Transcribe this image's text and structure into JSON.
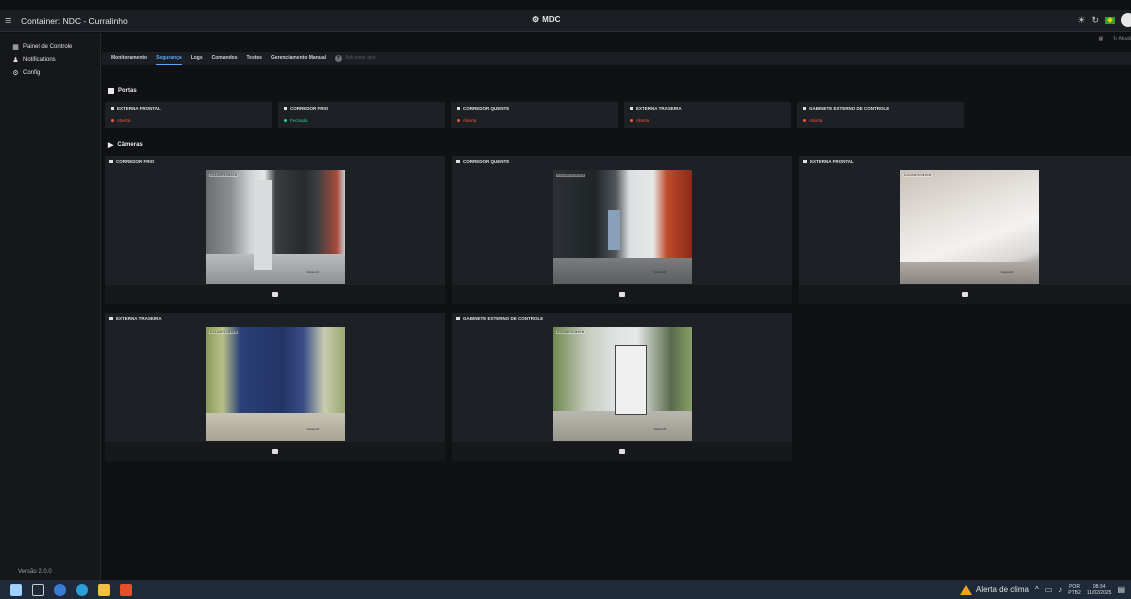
{
  "topbar": {
    "menu_icon": "menu-icon",
    "title": "Container: NDC - Curralinho",
    "center_icon": "gear-icon",
    "center_label": "MDC",
    "right_icons": [
      "sun-icon",
      "refresh-icon",
      "flag-icon",
      "avatar-icon"
    ]
  },
  "sidebar": {
    "items": [
      {
        "label": "Painel de Controle",
        "icon": "dashboard-icon"
      },
      {
        "label": "Notifications",
        "icon": "bell-icon"
      },
      {
        "label": "Config",
        "icon": "gear-icon"
      }
    ],
    "version": "Versão 2.0.0"
  },
  "toolbar_right": {
    "grid_icon": "grid-icon",
    "refresh_label": "Atuali"
  },
  "tabs": {
    "items": [
      "Monitoramento",
      "Segurança",
      "Logs",
      "Comandos",
      "Testes",
      "Gerenciamento Manual"
    ],
    "active": "Segurança",
    "add_label": "Adicionar aba"
  },
  "portas": {
    "title": "Portas",
    "doors": [
      {
        "name": "EXTERNA FRONTAL",
        "status": "Aberta",
        "color": "#f05a3a"
      },
      {
        "name": "CORREDOR FRIO",
        "status": "Fechada",
        "color": "#2ecc8a"
      },
      {
        "name": "CORREDOR QUENTE",
        "status": "Aberta",
        "color": "#f05a3a"
      },
      {
        "name": "EXTERNA TRASEIRA",
        "status": "Aberta",
        "color": "#f05a3a"
      },
      {
        "name": "GABINETE EXTERNO DE CONTROLE",
        "status": "Aberta",
        "color": "#f05a3a"
      }
    ]
  },
  "cameras": {
    "title": "Câmeras",
    "items": [
      {
        "name": "CORREDOR FRIO",
        "timestamp": "11-01-2025 Ter 08:33:45",
        "cam_label": "Camera 01"
      },
      {
        "name": "CORREDOR QUENTE",
        "timestamp": "11-01-2025 Ter 08:33:45",
        "cam_label": "Camera 02"
      },
      {
        "name": "EXTERNA FRONTAL",
        "timestamp": "11-01-2025 Ter 08:33:45",
        "cam_label": "Camera 03"
      },
      {
        "name": "EXTERNA TRASEIRA",
        "timestamp": "11-01-2025 Ter 08:33:45",
        "cam_label": "Camera 04"
      },
      {
        "name": "GABINETE EXTERNO DE CONTROLE",
        "timestamp": "11-01-2025 Ter 08:33:45",
        "cam_label": "Camera 05"
      }
    ]
  },
  "taskbar": {
    "weather": "Alerta de clima",
    "lang_top": "POR",
    "lang_bottom": "PTB2",
    "time": "08:34",
    "date": "11/02/2025"
  }
}
